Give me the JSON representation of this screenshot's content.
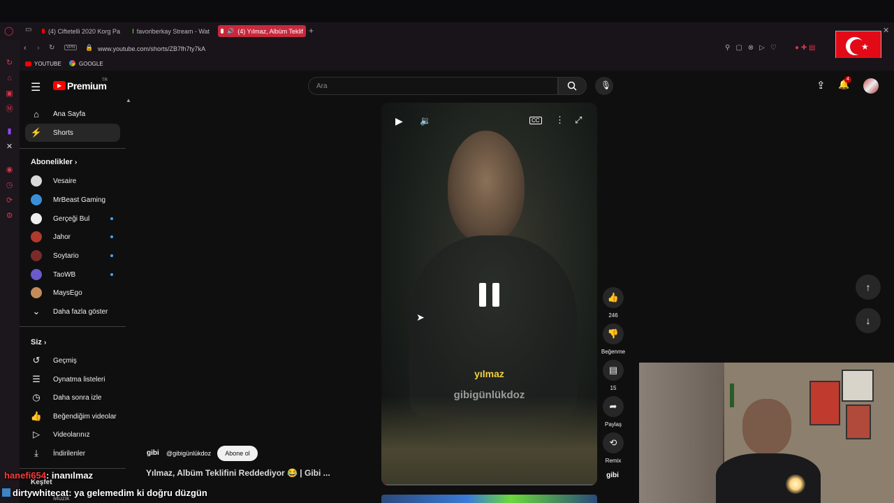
{
  "tabs": [
    {
      "label": "(4) Ciftetelli 2020 Korg Pa",
      "color": "#ff0000"
    },
    {
      "label": "favoriberkay Stream - Wat",
      "color": "#53fc18"
    },
    {
      "label": "(4) Yılmaz, Albüm Teklif",
      "color": "#ff0000"
    }
  ],
  "address": {
    "vpn": "VPN",
    "url": "www.youtube.com/shorts/ZB7fh7ty7kA"
  },
  "bookmarks": [
    {
      "label": "YOUTUBE"
    },
    {
      "label": "GOOGLE"
    }
  ],
  "yt": {
    "logo": "Premium",
    "logo_sup": "TR",
    "search_placeholder": "Ara",
    "notification_count": "4"
  },
  "sidebar": {
    "main": [
      {
        "label": "Ana Sayfa",
        "icon": "home-icon"
      },
      {
        "label": "Shorts",
        "icon": "shorts-icon"
      }
    ],
    "subs_title": "Abonelikler",
    "subs": [
      {
        "label": "Vesaire",
        "color": "#d9d9d9",
        "dot": false
      },
      {
        "label": "MrBeast Gaming",
        "color": "#3a8fd8",
        "dot": false
      },
      {
        "label": "Gerçeği Bul",
        "color": "#eeeeee",
        "dot": true
      },
      {
        "label": "Jahor",
        "color": "#b03a2e",
        "dot": true
      },
      {
        "label": "Soytario",
        "color": "#7a2a2a",
        "dot": true
      },
      {
        "label": "TaoWB",
        "color": "#6a5acd",
        "dot": true
      },
      {
        "label": "MaysEgo",
        "color": "#c58b5a",
        "dot": false
      }
    ],
    "show_more": "Daha fazla göster",
    "you_title": "Siz",
    "you": [
      {
        "label": "Geçmiş",
        "icon": "history-icon"
      },
      {
        "label": "Oynatma listeleri",
        "icon": "playlist-icon"
      },
      {
        "label": "Daha sonra izle",
        "icon": "clock-icon"
      },
      {
        "label": "Beğendiğim videolar",
        "icon": "thumbs-up-icon"
      },
      {
        "label": "Videolarınız",
        "icon": "video-icon"
      },
      {
        "label": "İndirilenler",
        "icon": "download-icon"
      }
    ],
    "explore": "Keşfet",
    "music": "Müzik"
  },
  "short": {
    "caption_line1": "yılmaz",
    "caption_line2": "gibigünlükdoz",
    "channel_badge": "gibi",
    "channel_handle": "@gibigünlükdoz",
    "subscribe": "Abone ol",
    "title": "Yılmaz, Albüm Teklifini Reddediyor 😂 | Gibi ...",
    "likes": "246",
    "dislike_label": "Beğenme",
    "comments": "15",
    "share": "Paylaş",
    "remix": "Remix",
    "channel_thumb": "gibi"
  },
  "chat": [
    {
      "user": "hanefi654",
      "msg": ": inanılmaz",
      "color": "#ff3b3b"
    },
    {
      "user": "dirtywhitecat",
      "msg": ": ya gelemedim ki doğru düzgün",
      "color": "#ffffff"
    }
  ]
}
